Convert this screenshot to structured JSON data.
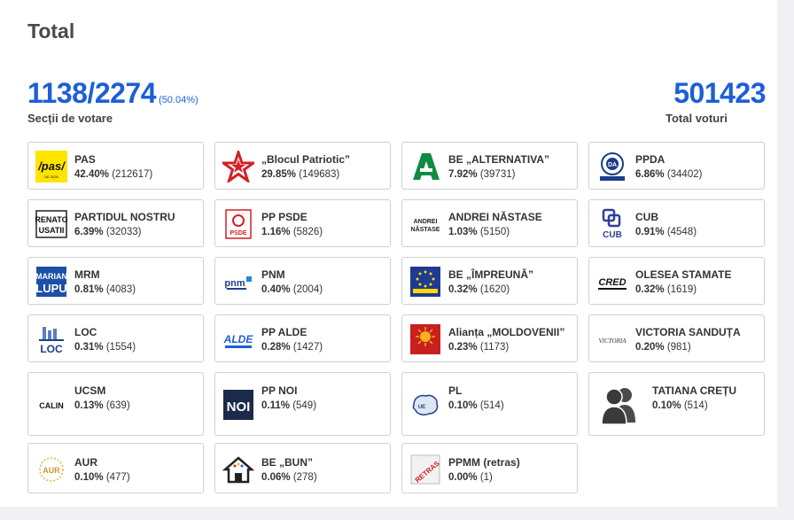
{
  "title": "Total",
  "stations": {
    "value": "1138/2274",
    "percent": "(50.04%)",
    "label": "Secții de votare"
  },
  "votes": {
    "value": "501423",
    "label": "Total voturi"
  },
  "cards": [
    {
      "name": "PAS",
      "pct": "42.40%",
      "votes": "(212617)",
      "logo": "pas-logo"
    },
    {
      "name": "„Blocul Patriotic”",
      "pct": "29.85%",
      "votes": "(149683)",
      "logo": "star-logo"
    },
    {
      "name": "BE „ALTERNATIVA”",
      "pct": "7.92%",
      "votes": "(39731)",
      "logo": "alternativa-logo"
    },
    {
      "name": "PPDA",
      "pct": "6.86%",
      "votes": "(34402)",
      "logo": "ppda-logo"
    },
    {
      "name": "PARTIDUL NOSTRU",
      "pct": "6.39%",
      "votes": "(32033)",
      "logo": "renato-usatii-logo",
      "logo_text": "RENATO USATII"
    },
    {
      "name": "PP PSDE",
      "pct": "1.16%",
      "votes": "(5826)",
      "logo": "psde-logo",
      "logo_text": "PSDE"
    },
    {
      "name": "ANDREI NĂSTASE",
      "pct": "1.03%",
      "votes": "(5150)",
      "logo": "andrei-nastase-logo",
      "logo_text": "ANDREI NĂSTASE"
    },
    {
      "name": "CUB",
      "pct": "0.91%",
      "votes": "(4548)",
      "logo": "cub-logo",
      "logo_text": "CUB"
    },
    {
      "name": "MRM",
      "pct": "0.81%",
      "votes": "(4083)",
      "logo": "marian-lupu-logo",
      "logo_text": "MARIAN LUPU"
    },
    {
      "name": "PNM",
      "pct": "0.40%",
      "votes": "(2004)",
      "logo": "pnm-logo",
      "logo_text": "pnm"
    },
    {
      "name": "BE „ÎMPREUNĂ”",
      "pct": "0.32%",
      "votes": "(1620)",
      "logo": "impreuna-logo"
    },
    {
      "name": "OLESEA STAMATE",
      "pct": "0.32%",
      "votes": "(1619)",
      "logo": "cred-logo",
      "logo_text": "CRED"
    },
    {
      "name": "LOC",
      "pct": "0.31%",
      "votes": "(1554)",
      "logo": "loc-logo",
      "logo_text": "LOC"
    },
    {
      "name": "PP ALDE",
      "pct": "0.28%",
      "votes": "(1427)",
      "logo": "alde-logo",
      "logo_text": "ALDE"
    },
    {
      "name": "Alianța „MOLDOVENII”",
      "pct": "0.23%",
      "votes": "(1173)",
      "logo": "moldovenii-logo"
    },
    {
      "name": "VICTORIA SANDUȚA",
      "pct": "0.20%",
      "votes": "(981)",
      "logo": "victoria-logo",
      "logo_text": "VICTORIA"
    },
    {
      "name": "UCSM",
      "pct": "0.13%",
      "votes": "(639)",
      "logo": "calin-logo",
      "logo_text": "CALIN"
    },
    {
      "name": "PP NOI",
      "pct": "0.11%",
      "votes": "(549)",
      "logo": "noi-logo",
      "logo_text": "NOI"
    },
    {
      "name": "PL",
      "pct": "0.10%",
      "votes": "(514)",
      "logo": "pl-logo"
    },
    {
      "name": "TATIANA CREȚU",
      "pct": "0.10%",
      "votes": "(514)",
      "logo": "people-icon"
    },
    {
      "name": "AUR",
      "pct": "0.10%",
      "votes": "(477)",
      "logo": "aur-logo",
      "logo_text": "AUR"
    },
    {
      "name": "BE „BUN”",
      "pct": "0.06%",
      "votes": "(278)",
      "logo": "bun-logo"
    },
    {
      "name": "PPMM (retras)",
      "pct": "0.00%",
      "votes": "(1)",
      "logo": "ppmm-logo",
      "logo_text": "RETRAS"
    }
  ],
  "colors": {
    "accent": "#1c5fd6",
    "pas_yellow": "#ffe400",
    "psde_red": "#d41f26",
    "alternativa_green": "#128a44"
  }
}
